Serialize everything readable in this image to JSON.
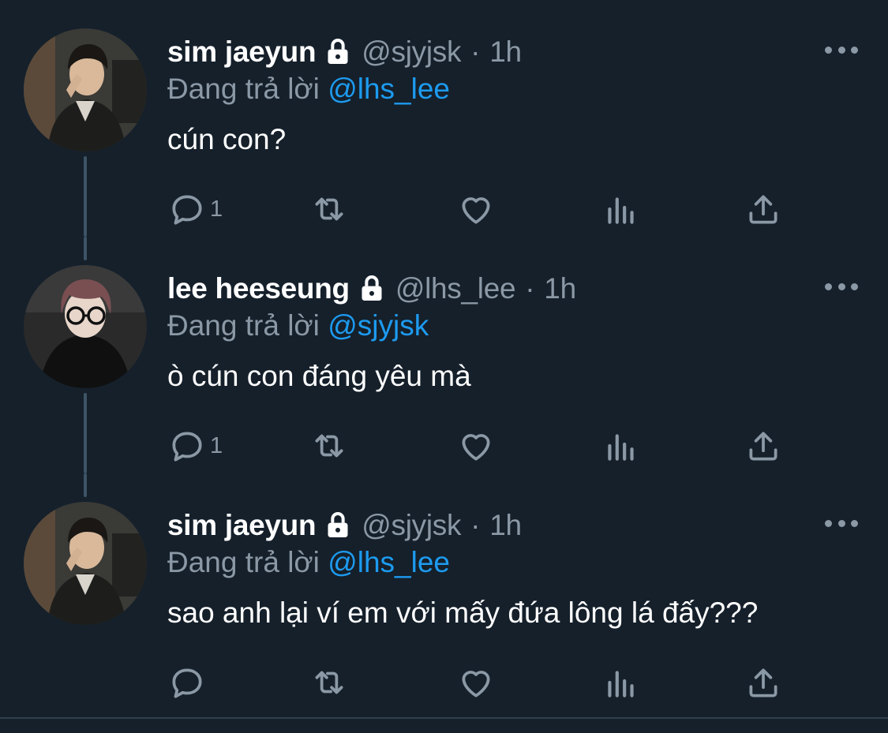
{
  "colors": {
    "background": "#15202b",
    "secondary_text": "#8b98a5",
    "mention": "#1d9bf0",
    "thread_line": "#3d5466"
  },
  "icons": {
    "lock": "lock-icon",
    "more": "more-icon",
    "reply": "reply-icon",
    "retweet": "retweet-icon",
    "like": "like-icon",
    "views": "views-icon",
    "share": "share-icon"
  },
  "tweets": [
    {
      "name": "sim jaeyun",
      "handle": "@sjyjsk",
      "separator": "·",
      "time": "1h",
      "replying_label": "Đang trả lời",
      "replying_to": "@lhs_lee",
      "text": "cún con?",
      "reply_count": "1"
    },
    {
      "name": "lee heeseung",
      "handle": "@lhs_lee",
      "separator": "·",
      "time": "1h",
      "replying_label": "Đang trả lời",
      "replying_to": "@sjyjsk",
      "text": "ò cún con đáng yêu mà",
      "reply_count": "1"
    },
    {
      "name": "sim jaeyun",
      "handle": "@sjyjsk",
      "separator": "·",
      "time": "1h",
      "replying_label": "Đang trả lời",
      "replying_to": "@lhs_lee",
      "text": "sao anh lại ví em với mấy đứa lông lá đấy???",
      "reply_count": ""
    }
  ]
}
